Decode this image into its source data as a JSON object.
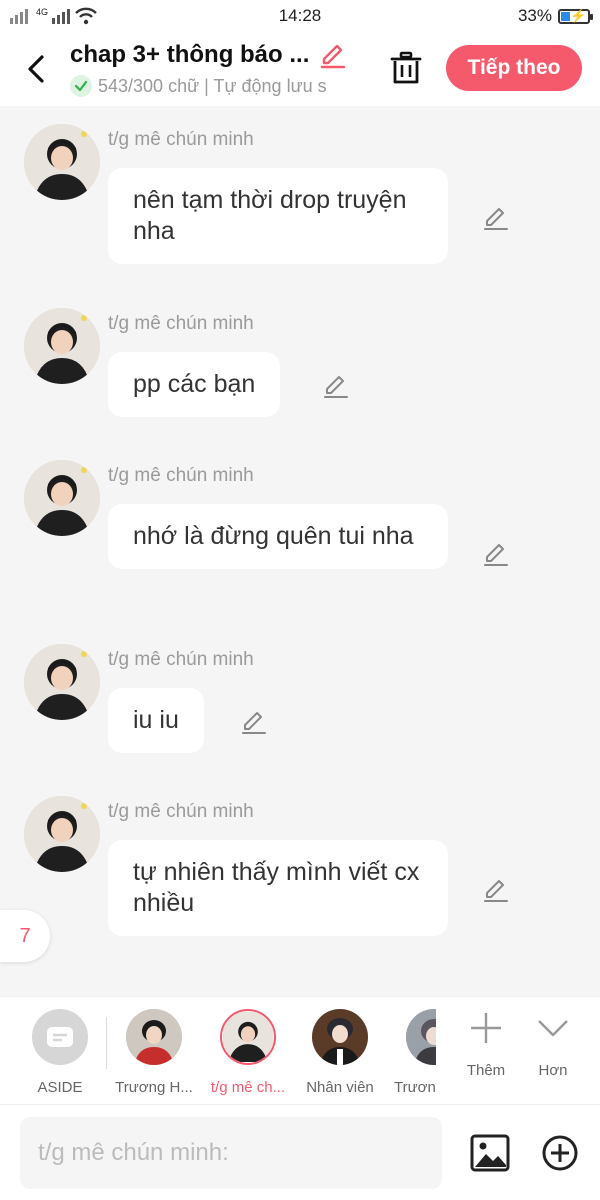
{
  "status_bar": {
    "network": "4G",
    "time": "14:28",
    "battery": "33%",
    "battery_level": 0.33
  },
  "header": {
    "title": "chap 3+ thông báo ...",
    "subtitle": "543/300 chữ | Tự động lưu s",
    "next_label": "Tiếp theo"
  },
  "messages": [
    {
      "author": "t/g mê chún minh",
      "text": "nên tạm thời drop truyện nha"
    },
    {
      "author": "t/g mê chún minh",
      "text": "pp các bạn"
    },
    {
      "author": "t/g mê chún minh",
      "text": "nhớ là đừng quên tui nha"
    },
    {
      "author": "t/g mê chún minh",
      "text": "iu iu"
    },
    {
      "author": "t/g mê chún minh",
      "text": "tự nhiên thấy mình viết cx nhiều"
    }
  ],
  "page_badge": "7",
  "characters": [
    {
      "label": "ASIDE"
    },
    {
      "label": "Trương H..."
    },
    {
      "label": "t/g mê ch...",
      "selected": true
    },
    {
      "label": "Nhân viên"
    },
    {
      "label": "Trươn"
    }
  ],
  "tools": {
    "add_label": "Thêm",
    "more_label": "Hơn"
  },
  "input": {
    "placeholder": "t/g mê chún minh:"
  },
  "colors": {
    "accent": "#f55a6c",
    "bubble": "#ffffff",
    "background": "#f5f5f5"
  }
}
